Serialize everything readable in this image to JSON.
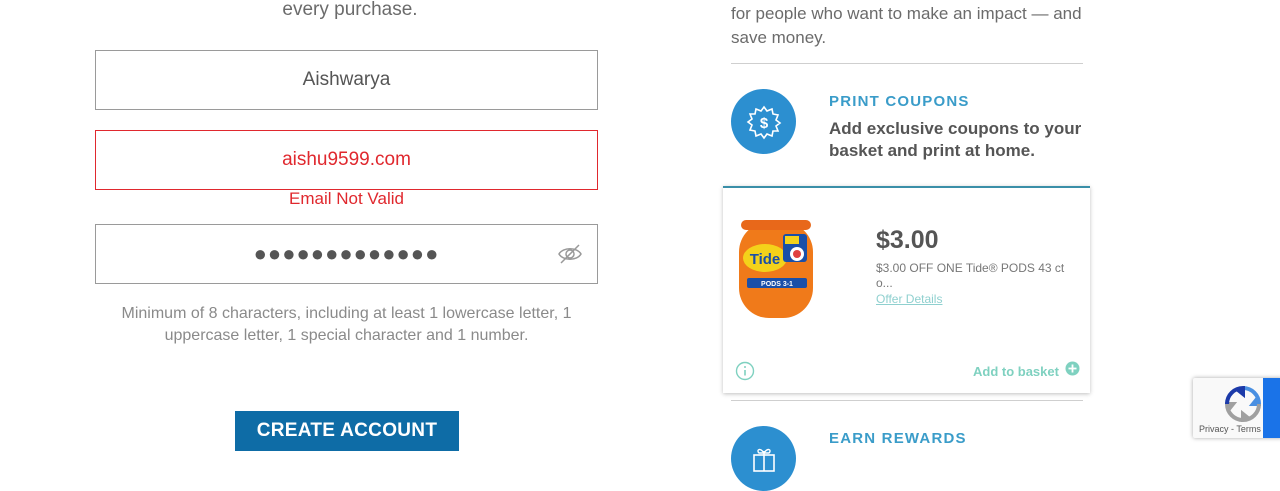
{
  "signup": {
    "intro_tail": "every purchase.",
    "first_name_value": "Aishwarya",
    "email_value": "aishu9599.com",
    "email_error": "Email Not Valid",
    "password_mask": "●●●●●●●●●●●●●",
    "password_hint": "Minimum of 8 characters, including at least 1 lowercase letter, 1 uppercase letter, 1 special character and 1 number.",
    "create_account_label": "CREATE ACCOUNT"
  },
  "benefits": {
    "intro_tail": "for people who want to make an impact — and save money.",
    "print_coupons": {
      "title": "PRINT COUPONS",
      "description": "Add exclusive coupons to your basket and print at home.",
      "icon": "dollar-badge-icon"
    },
    "coupon_card": {
      "price": "$3.00",
      "description": "$3.00 OFF ONE Tide® PODS 43 ct o...",
      "offer_details_label": "Offer Details",
      "add_to_basket_label": "Add to basket",
      "product_image": "tide-pods-tub"
    },
    "earn_rewards": {
      "title": "EARN REWARDS",
      "icon": "gift-icon"
    }
  },
  "recaptcha": {
    "terms_text": "Privacy - Terms"
  },
  "colors": {
    "primary_button": "#0e6ca6",
    "error": "#e0282e",
    "accent_blue": "#2c8fd0",
    "heading_teal": "#3a9cc9",
    "add_basket": "#7fd1c0"
  }
}
